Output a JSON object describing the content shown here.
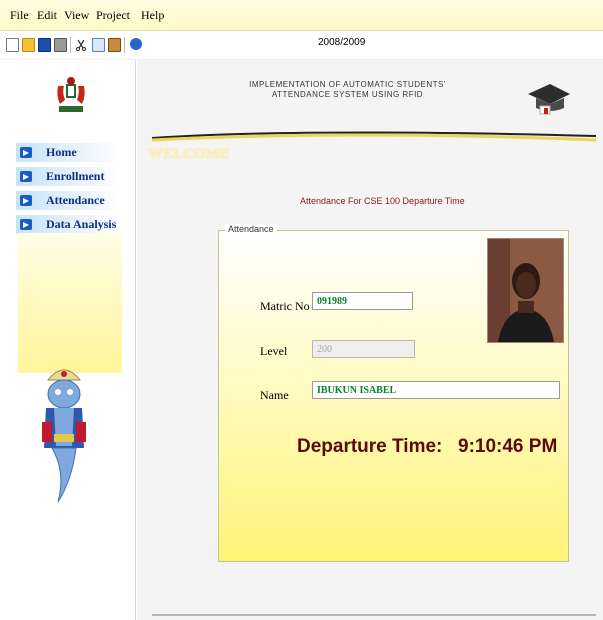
{
  "menu": [
    "File",
    "Edit",
    "View",
    "Project",
    "Help"
  ],
  "toolbar": {
    "icons": [
      "new-icon",
      "open-icon",
      "save-icon",
      "print-icon",
      "cut-icon",
      "copy-icon",
      "paste-icon",
      "help-icon"
    ],
    "year": "2008/2009"
  },
  "header": {
    "title_line1": "IMPLEMENTATION OF AUTOMATIC STUDENTS'",
    "title_line2": "ATTENDANCE SYSTEM USING RFID",
    "welcome": "WELCOME"
  },
  "sidebar": {
    "items": [
      {
        "label": "Home"
      },
      {
        "label": "Enrollment"
      },
      {
        "label": "Attendance"
      },
      {
        "label": "Data Analysis"
      }
    ]
  },
  "attendance": {
    "heading": "Attendance For CSE 100 Departure Time",
    "group_label": "Attendance",
    "matric_label": "Matric No",
    "matric_value": "091989",
    "level_label": "Level",
    "level_value": "200",
    "name_label": "Name",
    "name_value": "IBUKUN ISABEL",
    "departure_label": "Departure Time:",
    "departure_value": "9:10:46 PM"
  },
  "colors": {
    "nav_text": "#0b2e88",
    "heading": "#8b1b10",
    "departure": "#5b0a0a",
    "field_value": "#0a7f2d"
  }
}
